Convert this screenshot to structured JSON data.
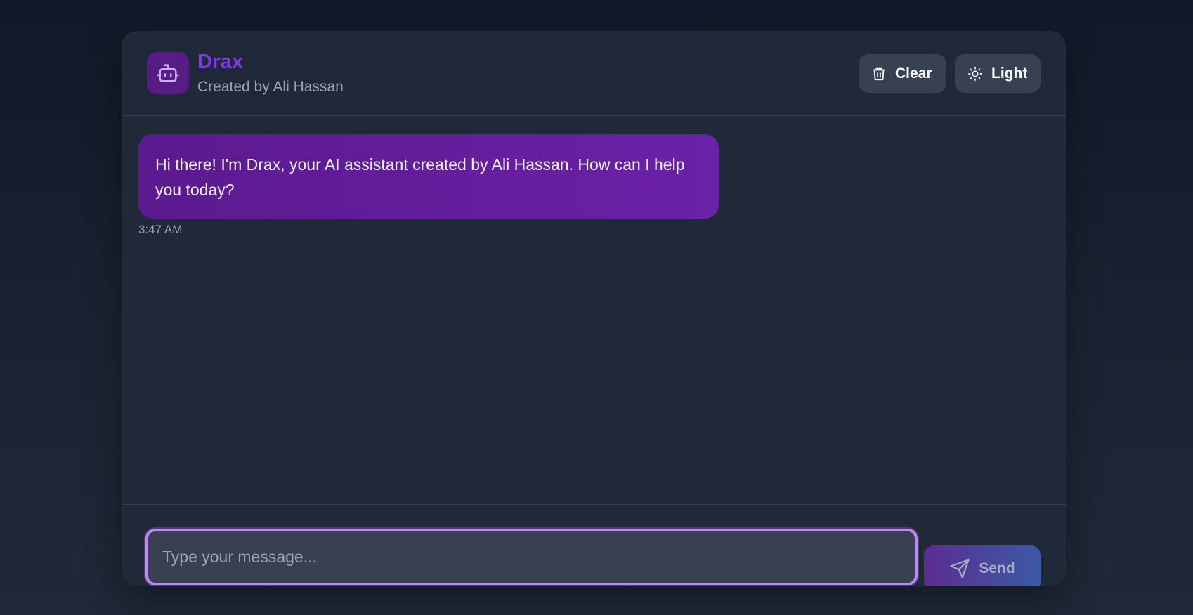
{
  "app": {
    "name": "Drax",
    "subtitle": "Created by Ali Hassan",
    "avatar_icon": "robot-icon"
  },
  "header": {
    "clear_label": "Clear",
    "clear_icon": "trash-icon",
    "theme_label": "Light",
    "theme_icon": "sun-icon"
  },
  "messages": [
    {
      "sender": "assistant",
      "text": "Hi there! I'm Drax, your AI assistant created by Ali Hassan. How can I help you today?",
      "time": "3:47 AM"
    }
  ],
  "composer": {
    "placeholder": "Type your message...",
    "value": "",
    "send_label": "Send",
    "send_icon": "send-icon"
  },
  "colors": {
    "accent": "#7e3ae6",
    "bubble": "#6b21a8",
    "input_border": "#c084fc"
  }
}
